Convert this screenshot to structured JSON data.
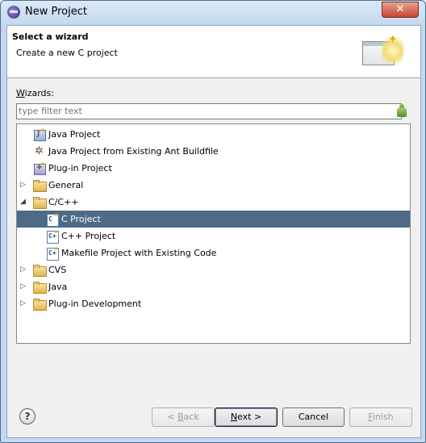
{
  "window": {
    "title": "New Project",
    "close_symbol": "✕"
  },
  "header": {
    "title": "Select a wizard",
    "description": "Create a new C project"
  },
  "wizards": {
    "label_mnemonic": "W",
    "label_rest": "izards:",
    "filter_placeholder": "type filter text"
  },
  "tree": {
    "items": [
      {
        "label": "Java Project",
        "icon": "java-project-icon"
      },
      {
        "label": "Java Project from Existing Ant Buildfile",
        "icon": "ant-icon"
      },
      {
        "label": "Plug-in Project",
        "icon": "plugin-project-icon"
      },
      {
        "label": "General",
        "icon": "folder-icon",
        "expander": "collapsed"
      },
      {
        "label": "C/C++",
        "icon": "folder-icon",
        "expander": "expanded"
      },
      {
        "label": "C Project",
        "icon": "c-project-icon",
        "selected": true
      },
      {
        "label": "C++ Project",
        "icon": "cpp-project-icon"
      },
      {
        "label": "Makefile Project with Existing Code",
        "icon": "makefile-project-icon"
      },
      {
        "label": "CVS",
        "icon": "folder-icon",
        "expander": "collapsed"
      },
      {
        "label": "Java",
        "icon": "folder-icon",
        "expander": "collapsed"
      },
      {
        "label": "Plug-in Development",
        "icon": "folder-icon",
        "expander": "collapsed"
      }
    ]
  },
  "buttons": {
    "help": "?",
    "back_prefix": "< ",
    "back_mnemonic": "B",
    "back_rest": "ack",
    "next_mnemonic": "N",
    "next_rest": "ext >",
    "cancel": "Cancel",
    "finish_mnemonic": "F",
    "finish_rest": "inish"
  },
  "colors": {
    "selection": "#4e6a85",
    "titlebar": "#c5d9ef",
    "close": "#c9442c"
  }
}
